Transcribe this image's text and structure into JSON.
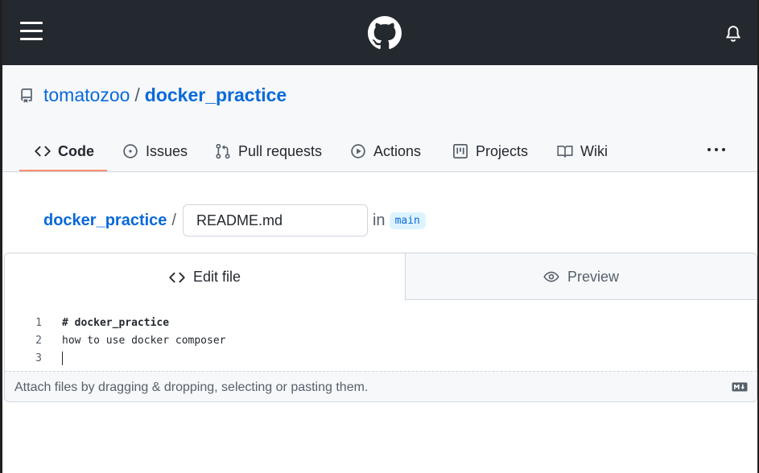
{
  "header": {
    "menu_icon": "hamburger-menu-icon",
    "logo_icon": "github-logo-icon",
    "notifications_icon": "bell-icon",
    "background_color": "#24292f"
  },
  "repo": {
    "owner": "tomatozoo",
    "separator": "/",
    "name": "docker_practice",
    "icon": "repo-icon"
  },
  "nav": {
    "tabs": [
      {
        "label": "Code",
        "icon": "code-icon",
        "active": true
      },
      {
        "label": "Issues",
        "icon": "issue-opened-icon"
      },
      {
        "label": "Pull requests",
        "icon": "git-pull-request-icon"
      },
      {
        "label": "Actions",
        "icon": "play-icon"
      },
      {
        "label": "Projects",
        "icon": "project-icon"
      },
      {
        "label": "Wiki",
        "icon": "book-icon"
      }
    ],
    "more_icon": "kebab-horizontal-icon",
    "active_underline_color": "#fd8c73"
  },
  "path": {
    "repo_link": "docker_practice",
    "separator": "/",
    "filename_value": "README.md",
    "in_label": "in",
    "branch": "main"
  },
  "editor": {
    "tab_edit": "Edit file",
    "tab_preview": "Preview",
    "lines": [
      {
        "number": "1",
        "text": "# docker_practice"
      },
      {
        "number": "2",
        "text": "how to use docker composer"
      },
      {
        "number": "3",
        "text": ""
      }
    ],
    "attach_text": "Attach files by dragging & dropping, selecting or pasting them.",
    "markdown_icon": "markdown-icon"
  },
  "colors": {
    "link": "#0969da",
    "border": "#d0d7de",
    "subtle_bg": "#f6f8fa",
    "muted_text": "#57606a"
  }
}
